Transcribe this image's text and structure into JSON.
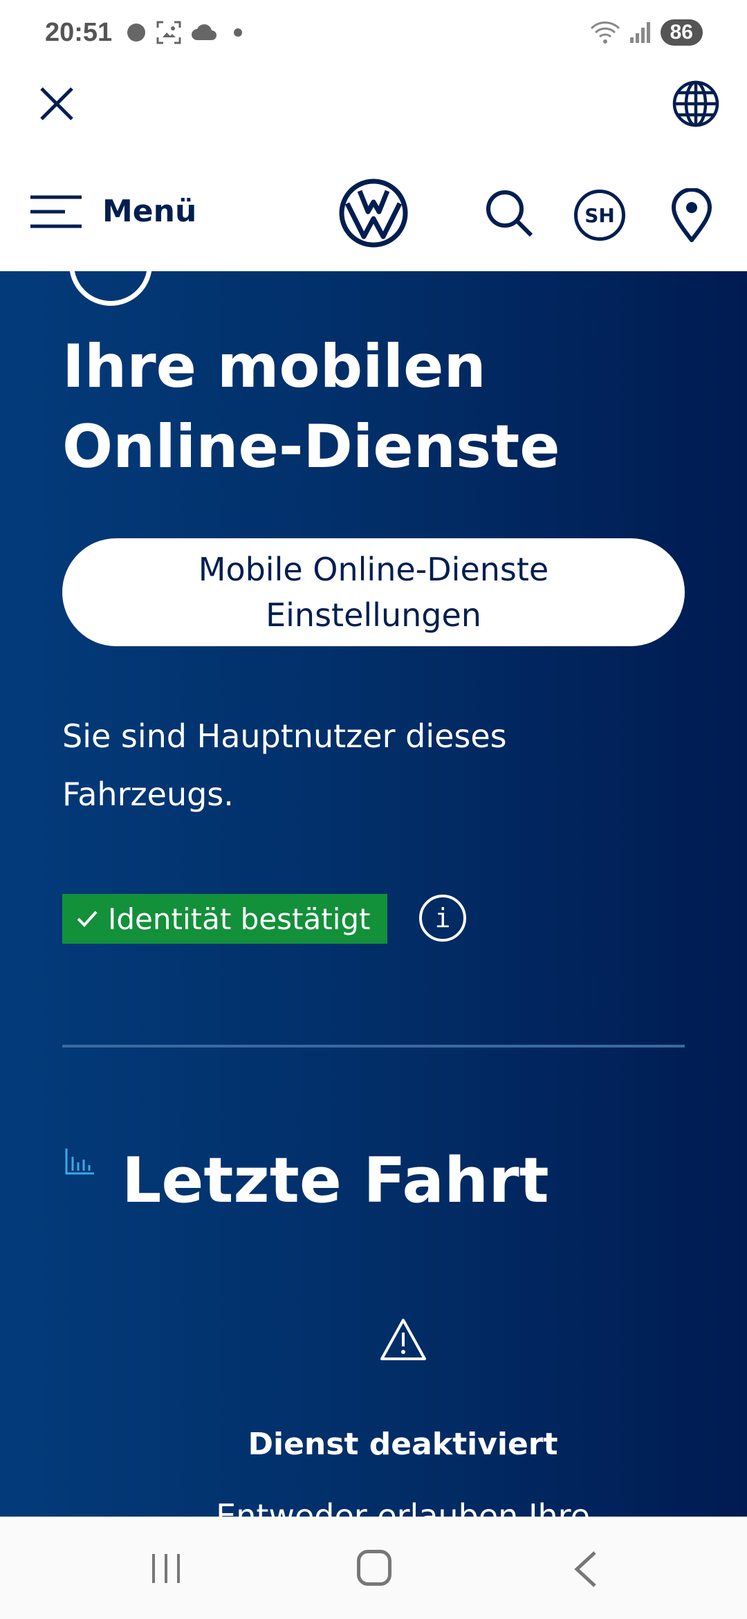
{
  "status_bar": {
    "time": "20:51",
    "battery": "86",
    "left_icons": [
      "record-dot-icon",
      "screenshot-icon",
      "cloud-icon",
      "dot-icon"
    ],
    "right_icons": [
      "wifi-icon",
      "signal-icon"
    ]
  },
  "top_bar": {
    "close_icon": "close-icon",
    "language_icon": "globe-icon"
  },
  "header": {
    "menu_label": "Menü",
    "logo": "vw-logo",
    "search_icon": "search-icon",
    "user_initials": "SH",
    "location_icon": "location-pin-icon"
  },
  "main": {
    "heading": "Ihre mobilen Online-Dienste",
    "settings_button_line1": "Mobile Online-Dienste",
    "settings_button_line2": "Einstellungen",
    "main_user_text": "Sie sind Hauptnutzer dieses Fahrzeugs.",
    "identity_badge": "Identität bestätigt",
    "info_icon_label": "i",
    "section_title": "Letzte Fahrt",
    "service_title": "Dienst deaktiviert",
    "service_description": "Entweder erlauben Ihre"
  },
  "colors": {
    "brand_dark": "#001e50",
    "badge_green": "#13903a",
    "accent_blue": "#3ea7e8"
  }
}
